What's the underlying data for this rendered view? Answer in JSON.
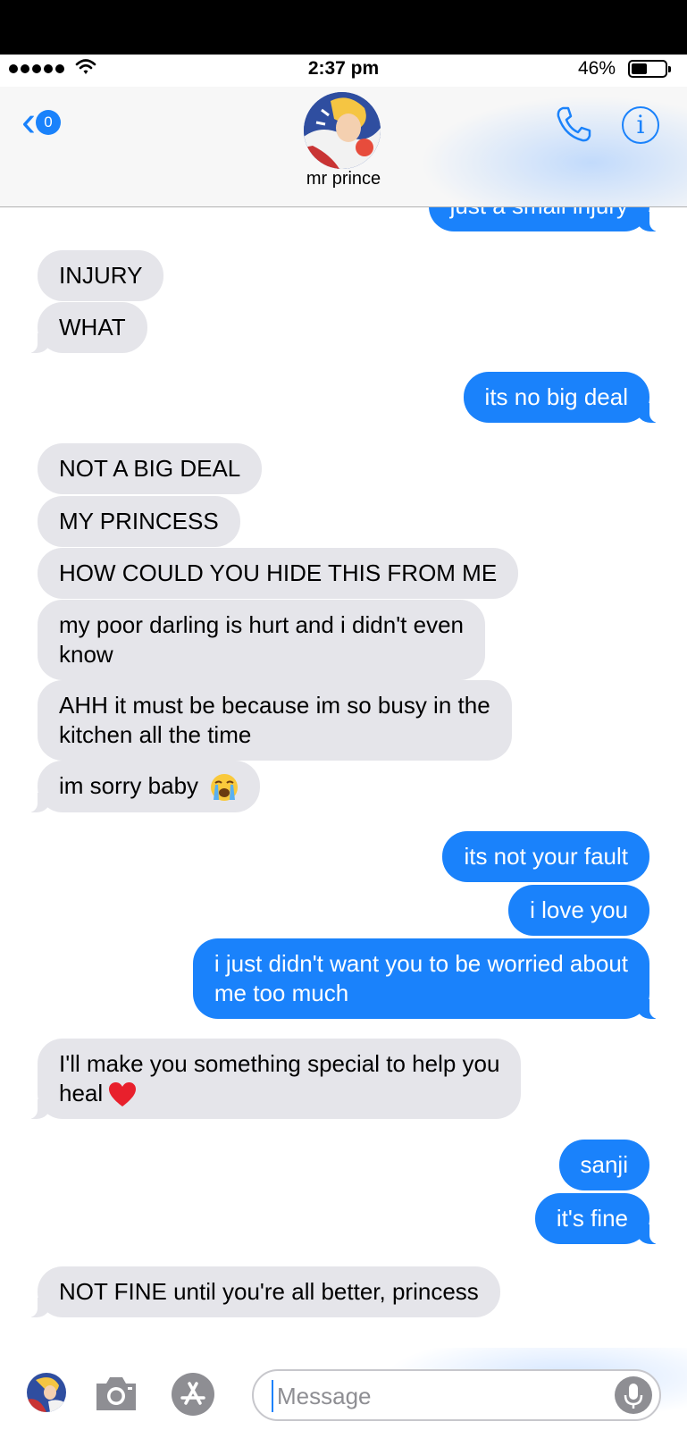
{
  "status_bar": {
    "time": "2:37 pm",
    "battery_percent": "46%",
    "battery_level": 0.46
  },
  "header": {
    "back_badge": "0",
    "contact_name": "mr prince",
    "info_glyph": "i",
    "icons": [
      "back-chevron-icon",
      "phone-icon",
      "info-icon"
    ]
  },
  "messages": [
    {
      "dir": "out",
      "text": "just a small injury"
    },
    {
      "dir": "in",
      "text": "INJURY"
    },
    {
      "dir": "in",
      "text": "WHAT"
    },
    {
      "dir": "out",
      "text": "its no big deal"
    },
    {
      "dir": "in",
      "text": "NOT A BIG DEAL"
    },
    {
      "dir": "in",
      "text": "MY PRINCESS"
    },
    {
      "dir": "in",
      "text": "HOW COULD YOU HIDE THIS FROM ME"
    },
    {
      "dir": "in",
      "text": "my poor darling is hurt and i didn't even",
      "text2": "know"
    },
    {
      "dir": "in",
      "text": "AHH it must be because im so busy in the",
      "text2": "kitchen all the time"
    },
    {
      "dir": "in",
      "text": "im sorry baby",
      "emoji": "loudly-crying-face-emoji"
    },
    {
      "dir": "out",
      "text": "its not your fault"
    },
    {
      "dir": "out",
      "text": "i love you"
    },
    {
      "dir": "out",
      "text": "i just didn't want you to be worried about",
      "text2": "me too much"
    },
    {
      "dir": "in",
      "text": "I'll make you something special to help you",
      "text2": "heal",
      "emoji": "red-heart-emoji"
    },
    {
      "dir": "out",
      "text": "sanji"
    },
    {
      "dir": "out",
      "text": "it's fine"
    },
    {
      "dir": "in",
      "text": "NOT FINE until you're all better, princess"
    }
  ],
  "composer": {
    "placeholder": "Message",
    "icons": [
      "camera-icon",
      "app-store-icon",
      "microphone-icon"
    ]
  },
  "colors": {
    "accent": "#1a82fb",
    "incoming_bubble": "#e5e5ea",
    "outgoing_bubble": "#1a82fb",
    "gray_icon": "#8e8e93"
  }
}
